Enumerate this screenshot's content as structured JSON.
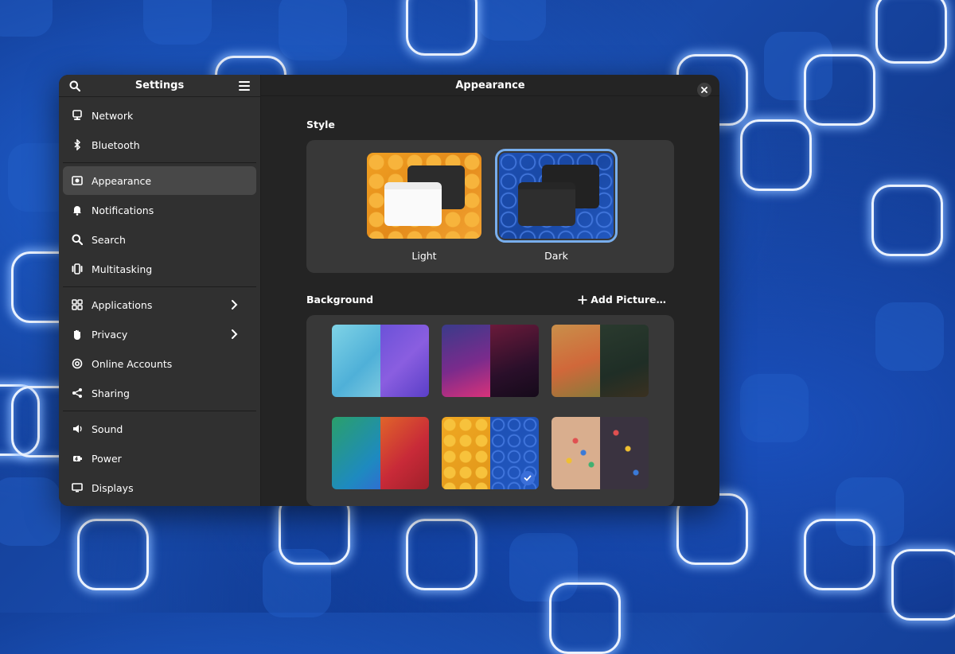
{
  "sidebar": {
    "title": "Settings",
    "items": [
      {
        "label": "Network",
        "icon": "network-icon"
      },
      {
        "label": "Bluetooth",
        "icon": "bluetooth-icon"
      },
      {
        "label": "Appearance",
        "icon": "appearance-icon",
        "active": true
      },
      {
        "label": "Notifications",
        "icon": "bell-icon"
      },
      {
        "label": "Search",
        "icon": "search-icon"
      },
      {
        "label": "Multitasking",
        "icon": "multitasking-icon"
      },
      {
        "label": "Applications",
        "icon": "applications-icon",
        "chevron": true
      },
      {
        "label": "Privacy",
        "icon": "hand-icon",
        "chevron": true
      },
      {
        "label": "Online Accounts",
        "icon": "at-icon"
      },
      {
        "label": "Sharing",
        "icon": "share-icon"
      },
      {
        "label": "Sound",
        "icon": "speaker-icon"
      },
      {
        "label": "Power",
        "icon": "power-icon"
      },
      {
        "label": "Displays",
        "icon": "display-icon"
      }
    ]
  },
  "main": {
    "title": "Appearance",
    "style_section": {
      "title": "Style",
      "options": [
        {
          "label": "Light",
          "selected": false
        },
        {
          "label": "Dark",
          "selected": true
        }
      ]
    },
    "background_section": {
      "title": "Background",
      "add_label": "Add Picture…"
    }
  },
  "colors": {
    "accent": "#78aeed",
    "window_bg": "#242424",
    "sidebar_bg": "#303030"
  }
}
